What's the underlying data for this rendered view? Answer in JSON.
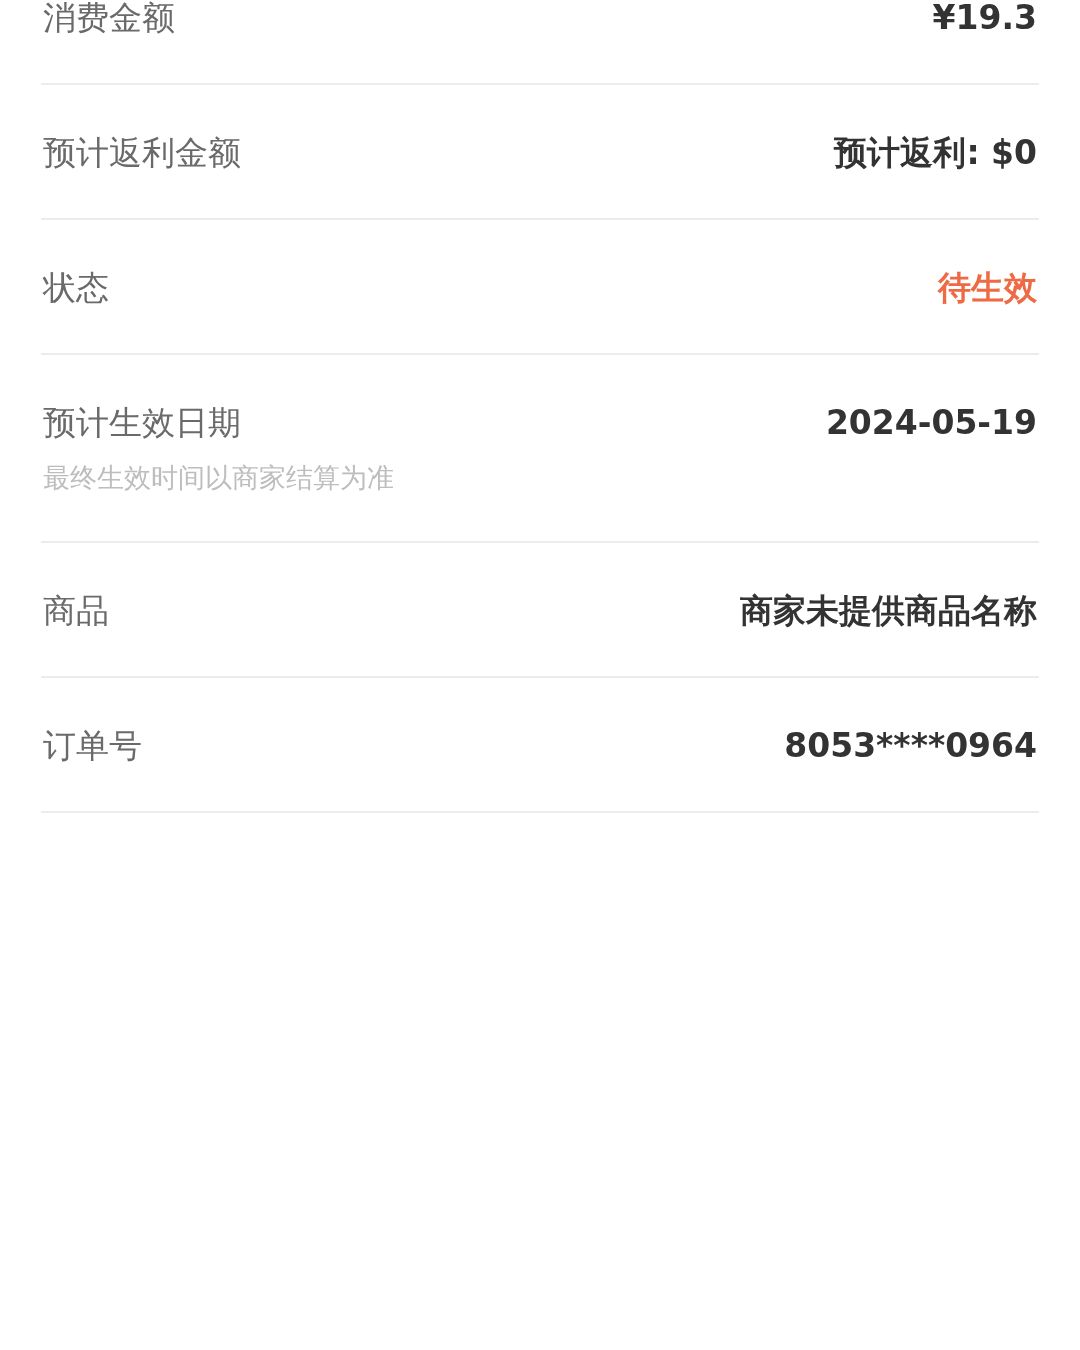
{
  "rows": [
    {
      "label": "消费金额",
      "value": "¥19.3"
    },
    {
      "label": "预计返利金额",
      "value": "预计返利: $0"
    },
    {
      "label": "状态",
      "value": "待生效",
      "color": "#ee6a45"
    },
    {
      "label": "预计生效日期",
      "value": "2024-05-19",
      "note": "最终生效时间以商家结算为准"
    },
    {
      "label": "商品",
      "value": "商家未提供商品名称"
    },
    {
      "label": "订单号",
      "value": "8053****0964"
    }
  ]
}
